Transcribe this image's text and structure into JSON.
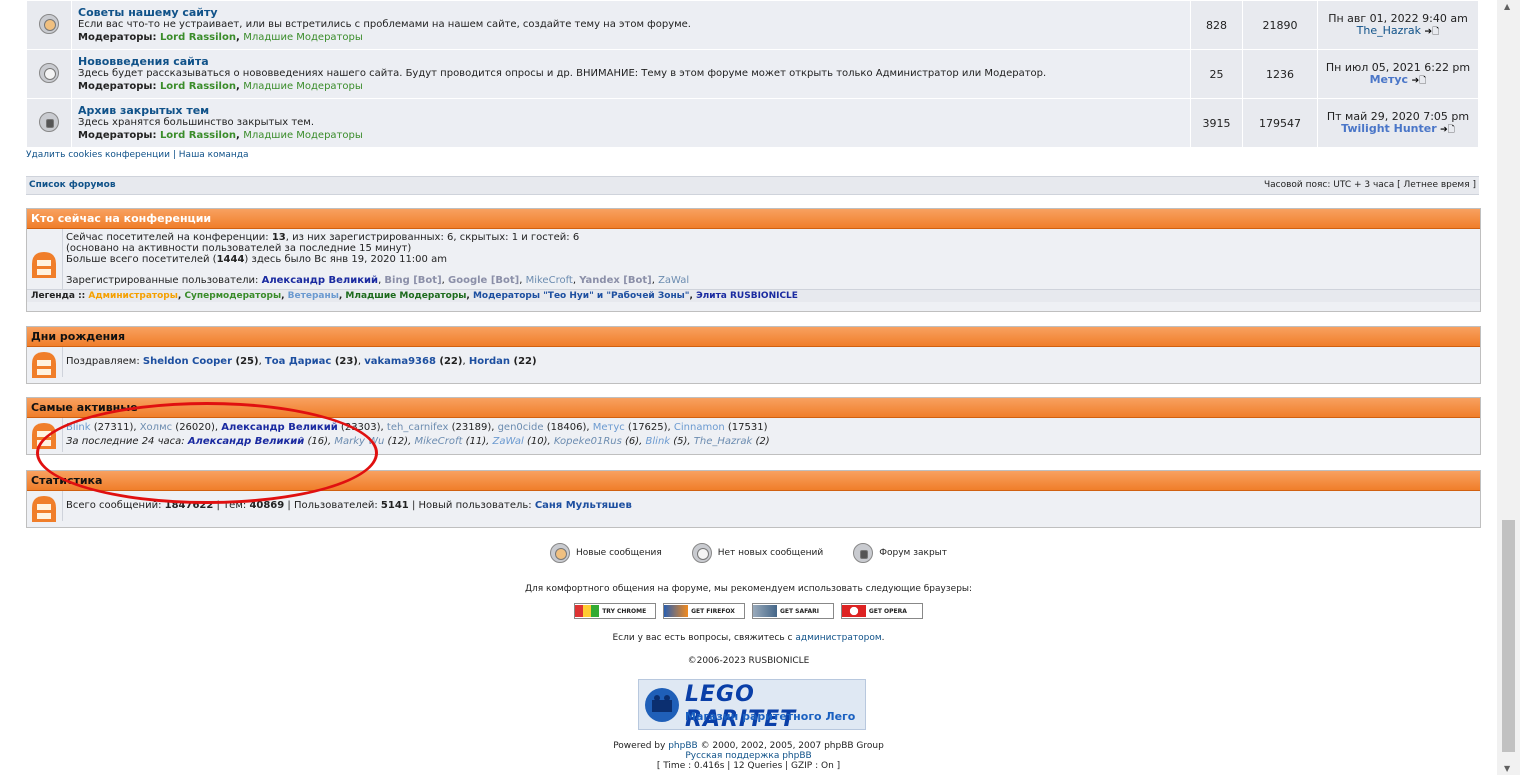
{
  "forums": [
    {
      "title": "Советы нашему сайту",
      "desc": "Если вас что-то не устраивает, или вы встретились с проблемами на нашем сайте, создайте тему на этом форуме.",
      "mods_label": "Модераторы:",
      "mod1": "Lord Rassilon",
      "mod2": "Младшие Модераторы",
      "topics": "828",
      "posts": "21890",
      "last_date": "Пн авг 01, 2022 9:40 am",
      "last_user": "The_Hazrak",
      "icon": "unread-forum-icon"
    },
    {
      "title": "Нововведения сайта",
      "desc": "Здесь будет рассказываться о нововведениях нашего сайта. Будут проводится опросы и др. ВНИМАНИЕ: Тему в этом форуме может открыть только Администратор или Модератор.",
      "mods_label": "Модераторы:",
      "mod1": "Lord Rassilon",
      "mod2": "Младшие Модераторы",
      "topics": "25",
      "posts": "1236",
      "last_date": "Пн июл 05, 2021 6:22 pm",
      "last_user": "Метус",
      "icon": "read-forum-icon"
    },
    {
      "title": "Архив закрытых тем",
      "desc": "Здесь хранятся большинство закрытых тем.",
      "mods_label": "Модераторы:",
      "mod1": "Lord Rassilon",
      "mod2": "Младшие Модераторы",
      "topics": "3915",
      "posts": "179547",
      "last_date": "Пт май 29, 2020 7:05 pm",
      "last_user": "Twilight Hunter",
      "icon": "locked-forum-icon"
    }
  ],
  "links": {
    "delete_cookies": "Удалить cookies конференции",
    "sep": " | ",
    "team": "Наша команда"
  },
  "navbar": {
    "forum_list": "Список форумов",
    "timezone": "Часовой пояс: UTC + 3 часа [ Летнее время ]"
  },
  "online": {
    "header": "Кто сейчас на конференции",
    "line1_a": "Сейчас посетителей на конференции: ",
    "line1_total": "13",
    "line1_b": ", из них зарегистрированных: 6, скрытых: 1 и гостей: 6",
    "line2": "(основано на активности пользователей за последние 15 минут)",
    "line3_a": "Больше всего посетителей (",
    "line3_max": "1444",
    "line3_b": ") здесь было Вс янв 19, 2020 11:00 am",
    "reg_label": "Зарегистрированные пользователи: ",
    "user1": "Александр Великий",
    "user2": "Bing [Bot]",
    "user3": "Google [Bot]",
    "user4": "MikeCroft",
    "user5": "Yandex [Bot]",
    "user6": "ZaWal",
    "legend_label": "Легенда :: ",
    "leg1": "Администраторы",
    "leg2": "Супермодераторы",
    "leg3": "Ветераны",
    "leg4": "Младшие Модераторы",
    "leg5": "Модераторы \"Тео Нуи\" и \"Рабочей Зоны\"",
    "leg6": "Элита RUSBIONICLE"
  },
  "birthdays": {
    "header": "Дни рождения",
    "label": "Поздравляем: ",
    "p1": "Sheldon Cooper",
    "a1": " (25)",
    "p2": "Тоа Дариас",
    "a2": " (23)",
    "p3": "vakama9368",
    "a3": " (22)",
    "p4": "Hordan",
    "a4": " (22)"
  },
  "active": {
    "header": "Самые активные",
    "u1": "Blink",
    "c1": " (27311), ",
    "u2": "Холмс",
    "c2": " (26020), ",
    "u3": "Александр Великий",
    "c3": " (23303), ",
    "u4": "teh_carnifex",
    "c4": " (23189), ",
    "u5": "gen0cide",
    "c5": " (18406), ",
    "u6": "Метус",
    "c6": " (17625), ",
    "u7": "Cinnamon",
    "c7": " (17531)",
    "day_label": "За последние 24 часа: ",
    "d1": "Александр Великий",
    "dc1": " (16), ",
    "d2": "Marky Wu",
    "dc2": " (12), ",
    "d3": "MikeCroft",
    "dc3": " (11), ",
    "d4": "ZaWal",
    "dc4": " (10), ",
    "d5": "Kopeke01Rus",
    "dc5": " (6), ",
    "d6": "Blink",
    "dc6": " (5), ",
    "d7": "The_Hazrak",
    "dc7": " (2)"
  },
  "stats": {
    "header": "Статистика",
    "a": "Всего сообщений: ",
    "posts": "1847622",
    "b": " | Тем: ",
    "topics": "40869",
    "c": " | Пользователей: ",
    "users": "5141",
    "d": " | Новый пользователь: ",
    "newuser": "Саня Мультяшев"
  },
  "footer": {
    "leg_new": "Новые сообщения",
    "leg_nonew": "Нет новых сообщений",
    "leg_locked": "Форум закрыт",
    "browsers": "Для комфортного общения на форуме, мы рекомендуем использовать следующие браузеры:",
    "b1": "TRY CHROME",
    "b2": "GET FIREFOX",
    "b3": "GET SAFARI",
    "b4": "GET OPERA",
    "contact_a": "Если у вас есть вопросы, свяжитесь с ",
    "contact_link": "администратором",
    "contact_b": ".",
    "copyright": "©2006-2023 RUSBIONICLE",
    "logo_big": "LEGO RARITET",
    "logo_small": "Магазин раритетного Лего",
    "powered_a": "Powered by ",
    "powered_link": "phpBB",
    "powered_b": " © 2000, 2002, 2005, 2007 phpBB Group",
    "russian": "Русская поддержка phpBB",
    "time": "[ Time : 0.416s | 12 Queries | GZIP : On ]"
  },
  "colors": {
    "header_orange": "#f07e2a",
    "link_blue": "#105289",
    "admin_orange": "#f5a000",
    "mod_green": "#3a8c2a",
    "annotation_red": "#e01010"
  }
}
